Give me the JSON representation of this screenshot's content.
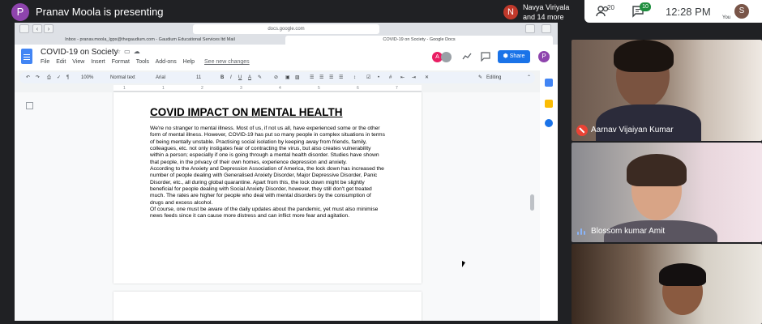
{
  "meet": {
    "presenter_initial": "P",
    "presenter_text": "Pranav Moola is presenting",
    "joiner_initial": "N",
    "joiner_name": "Navya Viriyala",
    "joiner_more": "and 14 more",
    "people_count": "20",
    "chat_count": "10",
    "time": "12:28 PM",
    "you_initial": "S",
    "you_label": "You"
  },
  "browser": {
    "address": "docs.google.com",
    "tabs": [
      {
        "label": "Inbox - pranav.moola_lgps@thegaudium.com - Gaudium Educational Services ltd Mail"
      },
      {
        "label": "COVID-19 on Society - Google Docs"
      }
    ]
  },
  "docs": {
    "title": "COVID-19 on Society",
    "menu": [
      "File",
      "Edit",
      "View",
      "Insert",
      "Format",
      "Tools",
      "Add-ons",
      "Help"
    ],
    "see_changes": "See new changes",
    "collaborator_initial": "A",
    "share_label": "Share",
    "account_initial": "P",
    "toolbar": {
      "zoom": "100%",
      "style": "Normal text",
      "font": "Arial",
      "size": "11",
      "mode": "Editing"
    },
    "ruler": [
      "1",
      "1",
      "2",
      "3",
      "4",
      "5",
      "6",
      "7"
    ],
    "heading": "COVID IMPACT ON MENTAL HEALTH",
    "paragraphs": [
      "We're no stranger to mental illness. Most of us, if not us all, have experienced some or the other form of mental illness. However, COVID-19 has put so many people in complex situations in terms of being mentally unstable. Practising social isolation by keeping away from friends, family, colleagues, etc. not only instigates fear of contracting the virus, but also creates vulnerability within a person; especially if one is going through a mental health disorder. Studies have shown that people, in the privacy of their own homes, experience depression and anxiety.",
      "According to the Anxiety and Depression Association of America, the lock down has increased the number of people dealing with Generalised Anxiety Disorder, Major Depressive Disorder, Panic Disorder, etc., all during global quarantine. Apart from this, the lock down might be slightly beneficial for people dealing with Social Anxiety Disorder, however, they still don't get treated much. The rates are higher for people who deal with mental disorders by the consumption of drugs and excess alcohol.",
      "Of course, one must be aware of the daily updates about the pandemic, yet must also minimise news feeds since it can cause more distress and can inflict more fear and agitation."
    ]
  },
  "participants": [
    {
      "name": "Aarnav Vijaiyan Kumar",
      "status": "muted"
    },
    {
      "name": "Blossom kumar Amit",
      "status": "speaking"
    },
    {
      "name": "",
      "status": ""
    }
  ]
}
